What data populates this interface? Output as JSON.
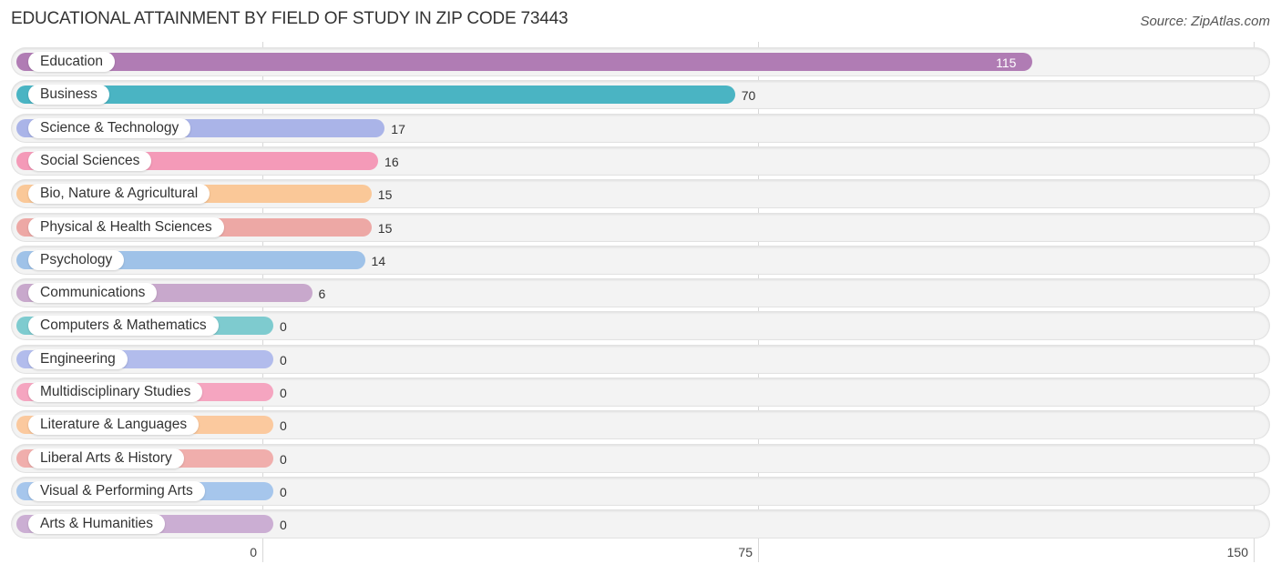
{
  "chart_data": {
    "type": "bar",
    "orientation": "horizontal",
    "title": "EDUCATIONAL ATTAINMENT BY FIELD OF STUDY IN ZIP CODE 73443",
    "source": "Source: ZipAtlas.com",
    "xlabel": "",
    "ylabel": "",
    "xlim": [
      0,
      150
    ],
    "xticks": [
      0,
      75,
      150
    ],
    "grid": true,
    "categories": [
      "Education",
      "Business",
      "Science & Technology",
      "Social Sciences",
      "Bio, Nature & Agricultural",
      "Physical & Health Sciences",
      "Psychology",
      "Communications",
      "Computers & Mathematics",
      "Engineering",
      "Multidisciplinary Studies",
      "Literature & Languages",
      "Liberal Arts & History",
      "Visual & Performing Arts",
      "Arts & Humanities"
    ],
    "values": [
      115,
      70,
      17,
      16,
      15,
      15,
      14,
      6,
      0,
      0,
      0,
      0,
      0,
      0,
      0
    ],
    "colors": [
      "#b07cb4",
      "#4ab4c3",
      "#aab4e8",
      "#f49ab8",
      "#fac898",
      "#eda8a5",
      "#9fc2e8",
      "#c8a8cc",
      "#7ecbcf",
      "#b2bcec",
      "#f5a5c0",
      "#fbc99e",
      "#f0aeac",
      "#a6c6ec",
      "#cbaed3"
    ]
  }
}
